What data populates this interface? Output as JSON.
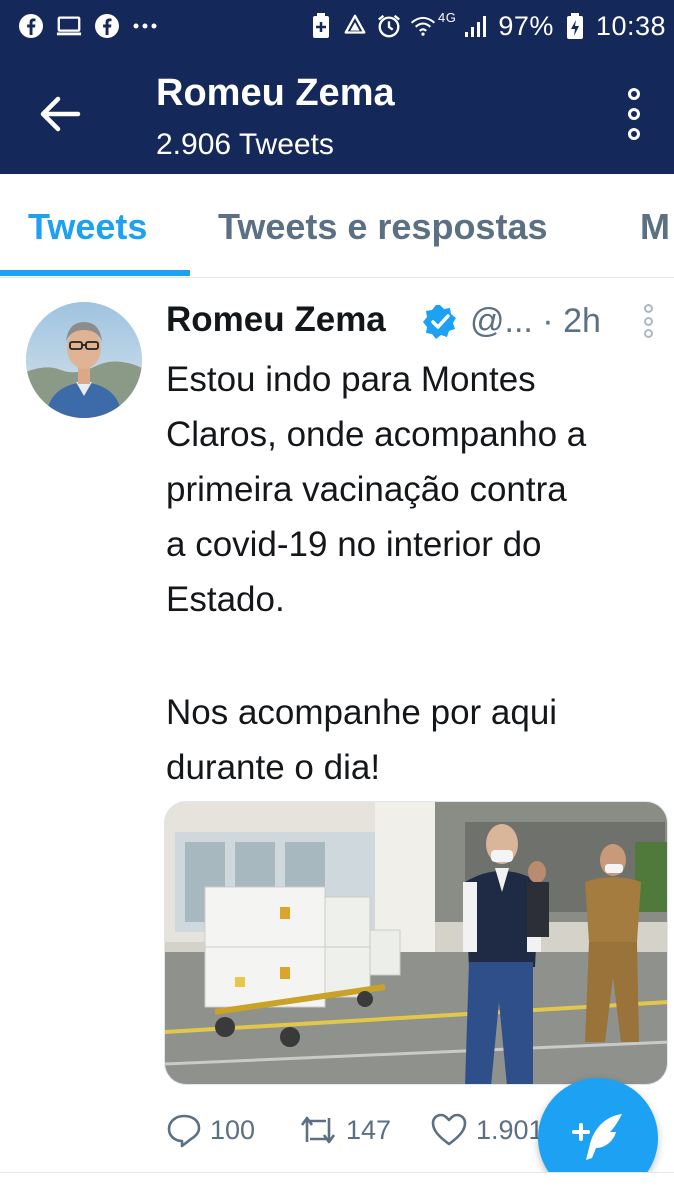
{
  "status_bar": {
    "left_icons": [
      "facebook-icon",
      "screen-cast-icon",
      "facebook-icon",
      "more-notifications-icon"
    ],
    "right_icons": [
      "data-saver-icon",
      "recycle-icon",
      "alarm-icon",
      "wifi-icon",
      "signal-icon",
      "battery-icon"
    ],
    "network_type": "4G",
    "battery_text": "97%",
    "time": "10:38"
  },
  "header": {
    "name": "Romeu Zema",
    "tweet_count": "2.906 Tweets",
    "back_icon": "arrow-left-icon",
    "more_icon": "more-vertical-icon"
  },
  "tabs": [
    {
      "label": "Tweets",
      "active": true
    },
    {
      "label": "Tweets e respostas",
      "active": false
    },
    {
      "label": "M",
      "active": false
    }
  ],
  "tweet": {
    "author_name": "Romeu Zema",
    "handle_time": "@... · 2h",
    "verified": true,
    "text_paragraph_1": [
      "Estou indo para Montes",
      "Claros, onde acompanho a",
      "primeira vacinação contra",
      "a covid-19 no interior do",
      "Estado."
    ],
    "text_paragraph_2": [
      "Nos acompanhe por aqui",
      "durante o dia!"
    ],
    "actions": {
      "reply_count": "100",
      "retweet_count": "147",
      "like_count": "1.901"
    }
  },
  "colors": {
    "header_bg": "#15285a",
    "accent": "#1da1f2",
    "secondary_text": "#5b7083",
    "primary_text": "#14171a",
    "divider": "#e1e8ed"
  },
  "fab_icon": "compose-tweet-icon"
}
